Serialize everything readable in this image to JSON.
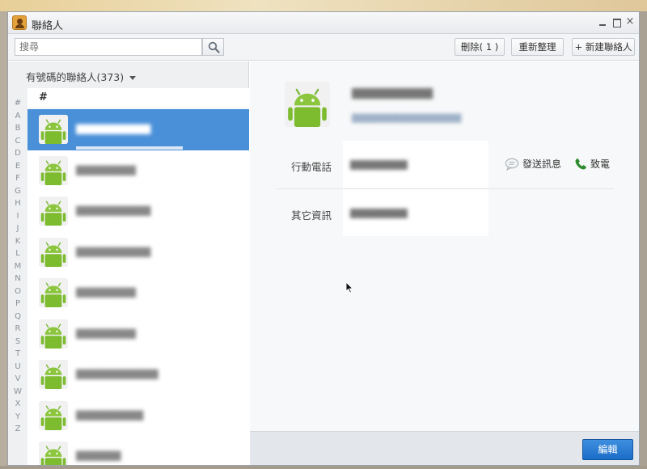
{
  "window": {
    "title": "聯絡人",
    "controls": {
      "close": "×"
    }
  },
  "toolbar": {
    "search_placeholder": "搜尋",
    "delete_label": "刪除( 1 )",
    "reorganize_label": "重新整理",
    "new_contact_label": "+ 新建聯絡人"
  },
  "sidebar": {
    "filter_label": "有號碼的聯絡人(373)",
    "alpha_index": [
      "#",
      "A",
      "B",
      "C",
      "D",
      "E",
      "F",
      "G",
      "H",
      "I",
      "J",
      "K",
      "L",
      "M",
      "N",
      "O",
      "P",
      "Q",
      "R",
      "S",
      "T",
      "U",
      "V",
      "W",
      "X",
      "Y",
      "Z"
    ],
    "group_header": "#",
    "contacts": [
      {
        "name": "▇▇▇▇▇▇▇▇▇▇",
        "selected": true
      },
      {
        "name": "▇▇▇▇▇▇▇▇"
      },
      {
        "name": "▇▇▇▇▇▇▇▇▇▇"
      },
      {
        "name": "▇▇▇▇▇▇▇▇▇▇"
      },
      {
        "name": "▇▇▇▇▇▇▇▇"
      },
      {
        "name": "▇▇▇▇▇▇▇▇"
      },
      {
        "name": "▇▇▇▇▇▇▇▇▇▇▇"
      },
      {
        "name": "▇▇▇▇▇▇▇▇▇"
      },
      {
        "name": "▇▇▇▇▇▇"
      }
    ]
  },
  "detail": {
    "name": "▇▇▇▇▇▇▇▇▇▇",
    "account": "▇▇▇▇▇▇▇▇▇▇▇▇▇▇▇▇",
    "phone_label": "行動電話",
    "phone_value": "▇▇▇▇▇▇▇▇",
    "send_message_label": "發送訊息",
    "call_label": "致電",
    "other_info_label": "其它資訊",
    "other_info_value": "▇▇▇▇▇▇▇▇"
  },
  "footer": {
    "edit_label": "編輯"
  },
  "colors": {
    "accent": "#4a90d9",
    "android_green": "#8bc34a",
    "edit_button": "#1b6cc8"
  },
  "icons": {
    "app": "contacts-book-icon",
    "search": "magnifier-icon",
    "avatar": "android-robot-icon",
    "message": "speech-bubble-icon",
    "call": "phone-handset-icon"
  }
}
